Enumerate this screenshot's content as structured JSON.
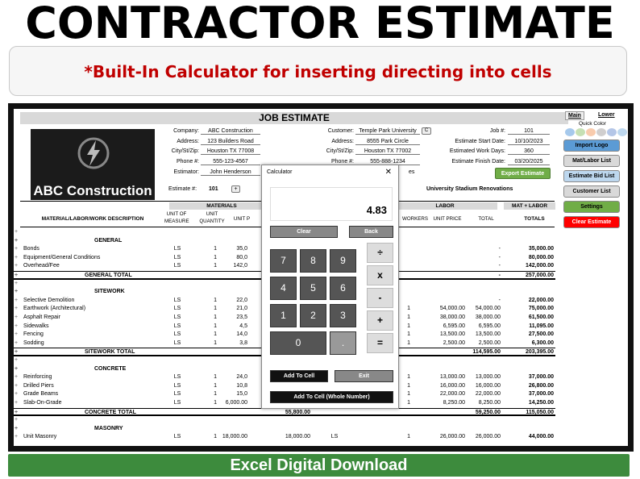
{
  "header": {
    "title": "CONTRACTOR ESTIMATE",
    "subtitle": "*Built-In Calculator for inserting directing into cells",
    "footer": "Excel Digital Download"
  },
  "sheet": {
    "title": "JOB ESTIMATE",
    "logo_text": "ABC Construction",
    "company": {
      "label": "Company:",
      "value": "ABC Construction"
    },
    "address": {
      "label": "Address:",
      "value": "123 Builders Road"
    },
    "citystzip": {
      "label": "City/St/Zip:",
      "value": "Houston TX 77008"
    },
    "phone": {
      "label": "Phone #:",
      "value": "555-123-4567"
    },
    "estimator": {
      "label": "Estimator:",
      "value": "John Henderson"
    },
    "estimate_no": {
      "label": "Estimate #:",
      "value": "101"
    },
    "customer": {
      "label": "Customer:",
      "value": "Temple Park University"
    },
    "c_address": {
      "label": "Address:",
      "value": "8555 Park Circle"
    },
    "c_citystzip": {
      "label": "City/St/Zip:",
      "value": "Houston TX 77002"
    },
    "c_phone": {
      "label": "Phone #:",
      "value": "555-888-1234"
    },
    "c_email": {
      "label": "Email:",
      "value": "es"
    },
    "job_no": {
      "label": "Job #:",
      "value": "101"
    },
    "start": {
      "label": "Estimate Start Date:",
      "value": "10/10/2023"
    },
    "workdays": {
      "label": "Estimated Work Days:",
      "value": "360"
    },
    "finish": {
      "label": "Estimate Finish Date:",
      "value": "03/20/2025"
    },
    "project": "University Stadium Renovations",
    "export": "Export Estimate",
    "customer_btn": "C",
    "plus_btn": "+"
  },
  "side": {
    "tab_main": "Main",
    "tab_lower": "Lower",
    "quick_color": "Quick Color",
    "colors": [
      "#a6c9ec",
      "#c6e0b4",
      "#f8cbad",
      "#d0cece",
      "#b4c6e7",
      "#bdd7ee"
    ],
    "buttons": [
      "Import Logo",
      "Mat/Labor List",
      "Estimate Bid List",
      "Customer List",
      "Settings",
      "Clear Estimate"
    ]
  },
  "table_head": {
    "materials": "MATERIALS",
    "labor": "LABOR",
    "matlabor": "MAT + LABOR",
    "desc": "MATERIAL/LABOR/WORK DESCRIPTION",
    "unit_measure": "UNIT OF MEASURE",
    "unit_qty": "UNIT QUANTITY",
    "unit_price_m": "UNIT P",
    "workers": "WORKERS",
    "unit_price": "UNIT PRICE",
    "total": "TOTAL",
    "totals": "TOTALS"
  },
  "rows": [
    {
      "t": "blank"
    },
    {
      "t": "sec",
      "d": "GENERAL"
    },
    {
      "t": "item",
      "d": "Bonds",
      "u": "LS",
      "q": "1",
      "p": "35,0",
      "lt": "-",
      "g": "35,000.00"
    },
    {
      "t": "item",
      "d": "Equipment/General Conditions",
      "u": "LS",
      "q": "1",
      "p": "80,0",
      "lt": "-",
      "g": "80,000.00"
    },
    {
      "t": "item",
      "d": "Overhead/Fee",
      "u": "LS",
      "q": "1",
      "p": "142,0",
      "lt": "-",
      "g": "142,000.00"
    },
    {
      "t": "tot",
      "d": "GENERAL TOTAL",
      "lt": "-",
      "g": "257,000.00"
    },
    {
      "t": "blank"
    },
    {
      "t": "sec",
      "d": "SITEWORK"
    },
    {
      "t": "item",
      "d": "Selective Demolition",
      "u": "LS",
      "q": "1",
      "p": "22,0",
      "lt": "-",
      "g": "22,000.00"
    },
    {
      "t": "item",
      "d": "Earthwork  (Architectural)",
      "u": "LS",
      "q": "1",
      "p": "21,0",
      "w": "1",
      "lp": "54,000.00",
      "lt": "54,000.00",
      "g": "75,000.00"
    },
    {
      "t": "item",
      "d": "Asphalt Repair",
      "u": "LS",
      "q": "1",
      "p": "23,5",
      "w": "1",
      "lp": "38,000.00",
      "lt": "38,000.00",
      "g": "61,500.00"
    },
    {
      "t": "item",
      "d": "Sidewalks",
      "u": "LS",
      "q": "1",
      "p": "4,5",
      "w": "1",
      "lp": "6,595.00",
      "lt": "6,595.00",
      "g": "11,095.00"
    },
    {
      "t": "item",
      "d": "Fencing",
      "u": "LS",
      "q": "1",
      "p": "14,0",
      "w": "1",
      "lp": "13,500.00",
      "lt": "13,500.00",
      "g": "27,500.00"
    },
    {
      "t": "item",
      "d": "Sodding",
      "u": "LS",
      "q": "1",
      "p": "3,8",
      "w": "1",
      "lp": "2,500.00",
      "lt": "2,500.00",
      "g": "6,300.00"
    },
    {
      "t": "tot",
      "d": "SITEWORK TOTAL",
      "lt": "114,595.00",
      "g": "203,395.00"
    },
    {
      "t": "blank"
    },
    {
      "t": "sec",
      "d": "CONCRETE"
    },
    {
      "t": "item",
      "d": "Reinforcing",
      "u": "LS",
      "q": "1",
      "p": "24,0",
      "w": "1",
      "lp": "13,000.00",
      "lt": "13,000.00",
      "g": "37,000.00"
    },
    {
      "t": "item",
      "d": "Drilled Piers",
      "u": "LS",
      "q": "1",
      "p": "10,8",
      "w": "1",
      "lp": "16,000.00",
      "lt": "16,000.00",
      "g": "26,800.00"
    },
    {
      "t": "item",
      "d": "Grade Beams",
      "u": "LS",
      "q": "1",
      "p": "15,0",
      "w": "1",
      "lp": "22,000.00",
      "lt": "22,000.00",
      "g": "37,000.00"
    },
    {
      "t": "item",
      "d": "Slab-On-Grade",
      "u": "LS",
      "q": "1",
      "p": "6,000.00",
      "mt": "6,000.00",
      "lu": "LS",
      "w": "1",
      "lp": "8,250.00",
      "lt": "8,250.00",
      "g": "14,250.00"
    },
    {
      "t": "tot",
      "d": "CONCRETE TOTAL",
      "mt": "55,800.00",
      "lt": "59,250.00",
      "g": "115,050.00"
    },
    {
      "t": "blank"
    },
    {
      "t": "sec",
      "d": "MASONRY"
    },
    {
      "t": "item",
      "d": "Unit Masonry",
      "u": "LS",
      "q": "1",
      "p": "18,000.00",
      "mt": "18,000.00",
      "lu": "LS",
      "w": "1",
      "lp": "26,000.00",
      "lt": "26,000.00",
      "g": "44,000.00"
    }
  ],
  "calc": {
    "title": "Calculator",
    "close": "✕",
    "display": "4.83",
    "clear": "Clear",
    "back": "Back",
    "digits": [
      "7",
      "8",
      "9",
      "4",
      "5",
      "6",
      "1",
      "2",
      "3",
      "0",
      "."
    ],
    "ops": [
      "÷",
      "x",
      "-",
      "+",
      "="
    ],
    "add": "Add To Cell",
    "exit": "Exit",
    "add_whole": "Add To Cell (Whole Number)"
  }
}
